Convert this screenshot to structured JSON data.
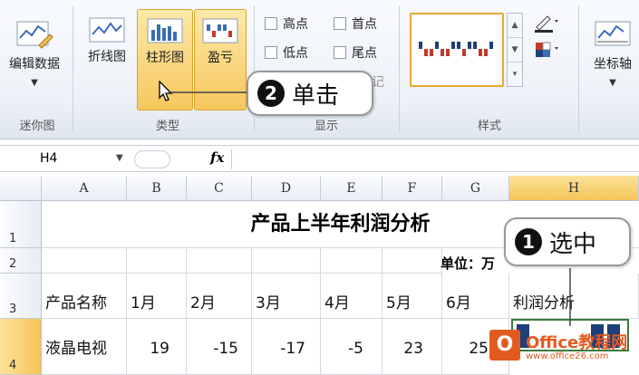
{
  "ribbon": {
    "groups": {
      "sparkline": "迷你图",
      "type": "类型",
      "show": "显示",
      "style": "样式"
    },
    "buttons": {
      "edit_data": "编辑数据",
      "line": "折线图",
      "column": "柱形图",
      "win_loss": "盈亏",
      "axis": "坐标轴"
    },
    "checks": {
      "high": "高点",
      "low": "低点",
      "first": "首点",
      "last": "尾点",
      "marker_partial": "记"
    }
  },
  "callouts": {
    "step2": {
      "num": "2",
      "text": "单击"
    },
    "step1": {
      "num": "1",
      "text": "选中"
    }
  },
  "formula_bar": {
    "name_box": "H4",
    "fx": "fx"
  },
  "columns": [
    "A",
    "B",
    "C",
    "D",
    "E",
    "F",
    "G",
    "H"
  ],
  "rows": [
    "1",
    "2",
    "3",
    "4"
  ],
  "sheet": {
    "title": "产品上半年利润分析",
    "unit": "单位：万",
    "headers": [
      "产品名称",
      "1月",
      "2月",
      "3月",
      "4月",
      "5月",
      "6月",
      "利润分析"
    ],
    "row4": [
      "液晶电视",
      "19",
      "-15",
      "-17",
      "-5",
      "23",
      "25"
    ]
  },
  "watermark": {
    "logo": "O",
    "text": "Office教程网",
    "url": "www.office26.com"
  },
  "colors": {
    "accent": "#f6c75e",
    "bar_pos": "#1f3f7a",
    "bar_neg": "#c0392b",
    "selection": "#3d7a3a"
  }
}
